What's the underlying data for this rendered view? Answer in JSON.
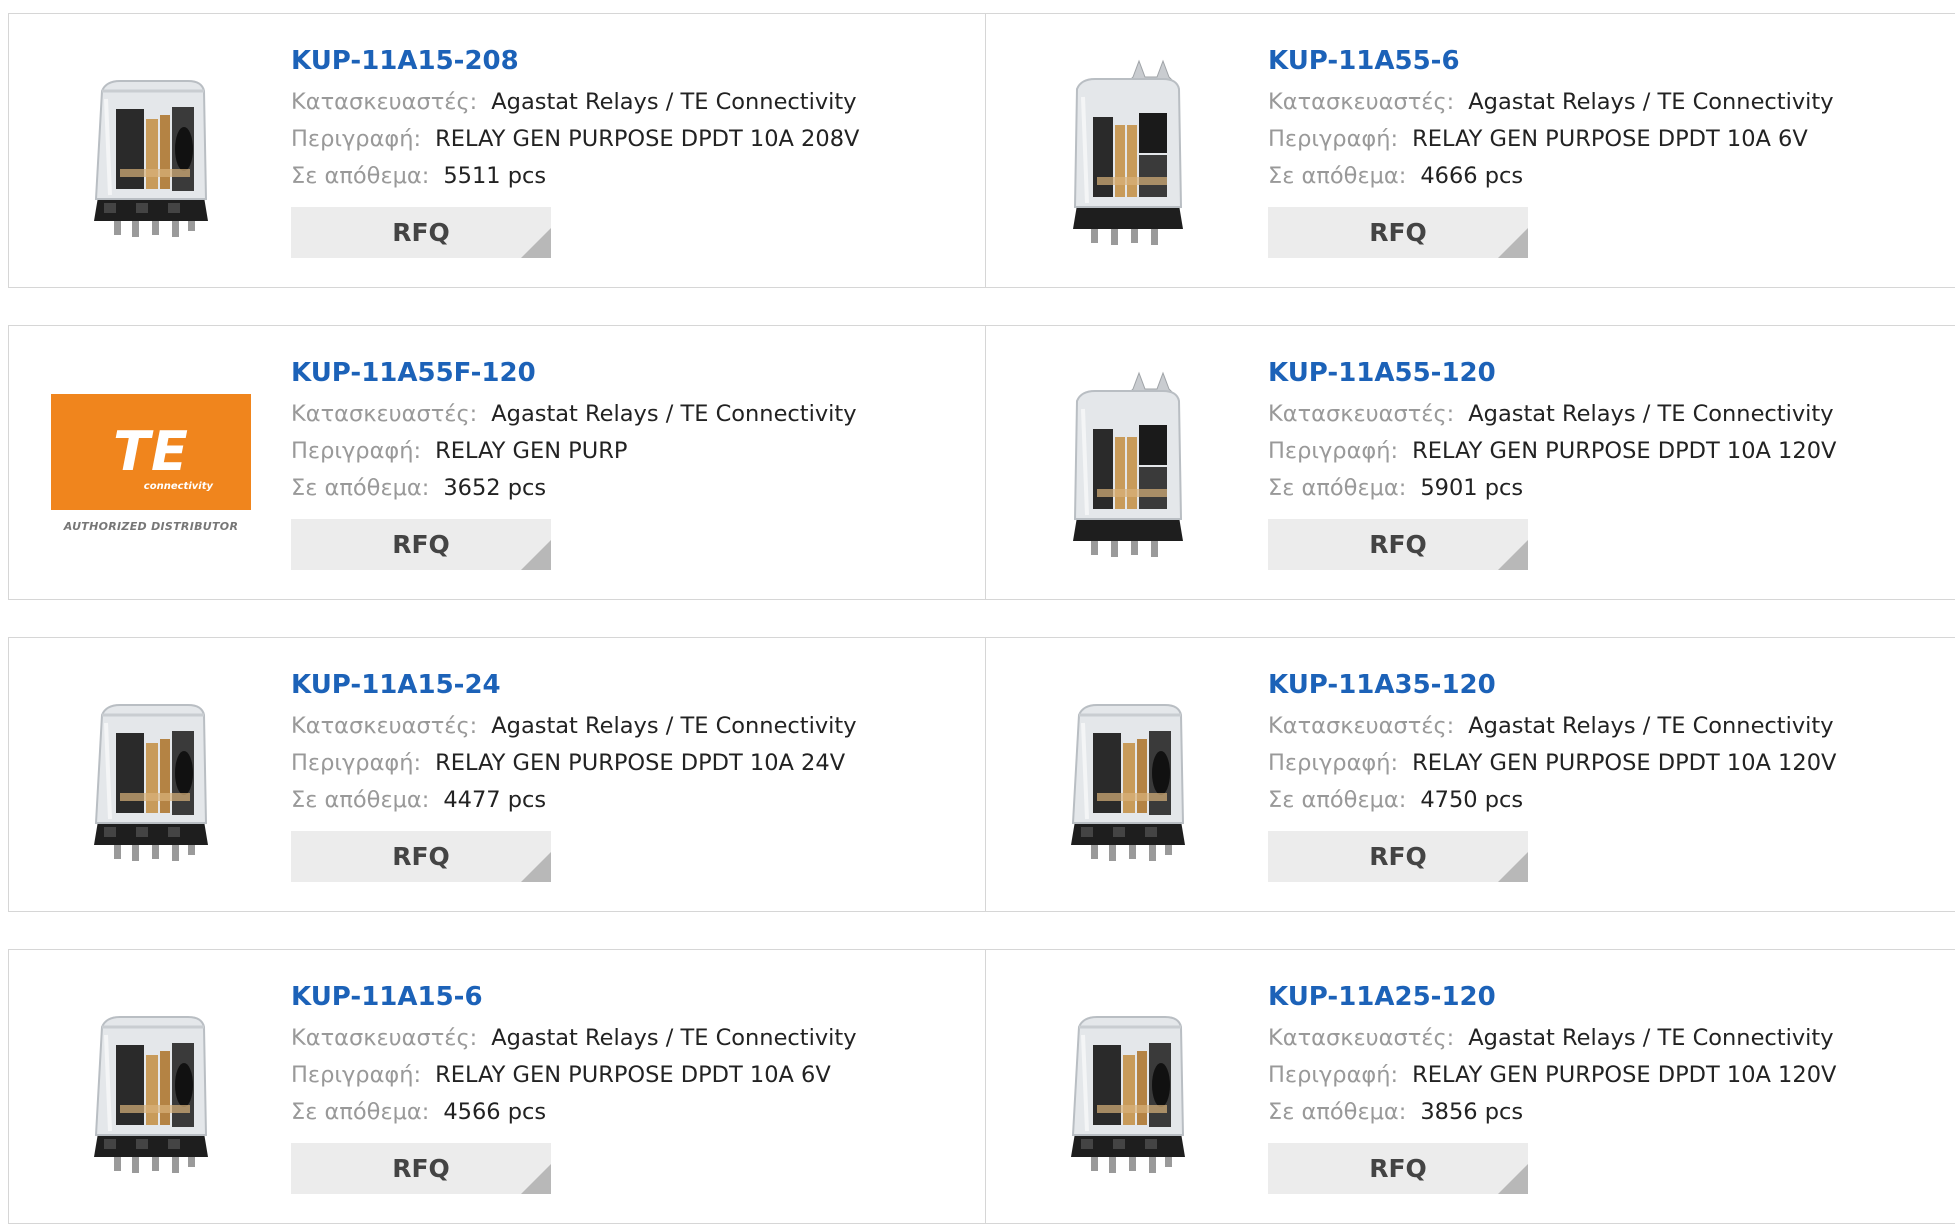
{
  "labels": {
    "manufacturer": "Κατασκευαστές:",
    "description": "Περιγραφή:",
    "stock": "Σε απόθεμα:",
    "rfq": "RFQ"
  },
  "logo": {
    "text": "TE",
    "sub": "connectivity",
    "tagline": "AUTHORIZED DISTRIBUTOR",
    "color": "#f0851d"
  },
  "products": [
    {
      "part": "KUP-11A15-208",
      "manufacturer": "Agastat Relays / TE Connectivity",
      "description": "RELAY GEN PURPOSE DPDT 10A 208V",
      "stock": "5511 pcs",
      "image": "relay-icon"
    },
    {
      "part": "KUP-11A55-6",
      "manufacturer": "Agastat Relays / TE Connectivity",
      "description": "RELAY GEN PURPOSE DPDT 10A 6V",
      "stock": "4666 pcs",
      "image": "relay-flange-icon"
    },
    {
      "part": "KUP-11A55F-120",
      "manufacturer": "Agastat Relays / TE Connectivity",
      "description": "RELAY GEN PURP",
      "stock": "3652 pcs",
      "image": "te-logo"
    },
    {
      "part": "KUP-11A55-120",
      "manufacturer": "Agastat Relays / TE Connectivity",
      "description": "RELAY GEN PURPOSE DPDT 10A 120V",
      "stock": "5901 pcs",
      "image": "relay-flange-icon"
    },
    {
      "part": "KUP-11A15-24",
      "manufacturer": "Agastat Relays / TE Connectivity",
      "description": "RELAY GEN PURPOSE DPDT 10A 24V",
      "stock": "4477 pcs",
      "image": "relay-icon"
    },
    {
      "part": "KUP-11A35-120",
      "manufacturer": "Agastat Relays / TE Connectivity",
      "description": "RELAY GEN PURPOSE DPDT 10A 120V",
      "stock": "4750 pcs",
      "image": "relay-icon"
    },
    {
      "part": "KUP-11A15-6",
      "manufacturer": "Agastat Relays / TE Connectivity",
      "description": "RELAY GEN PURPOSE DPDT 10A 6V",
      "stock": "4566 pcs",
      "image": "relay-icon"
    },
    {
      "part": "KUP-11A25-120",
      "manufacturer": "Agastat Relays / TE Connectivity",
      "description": "RELAY GEN PURPOSE DPDT 10A 120V",
      "stock": "3856 pcs",
      "image": "relay-icon"
    }
  ]
}
